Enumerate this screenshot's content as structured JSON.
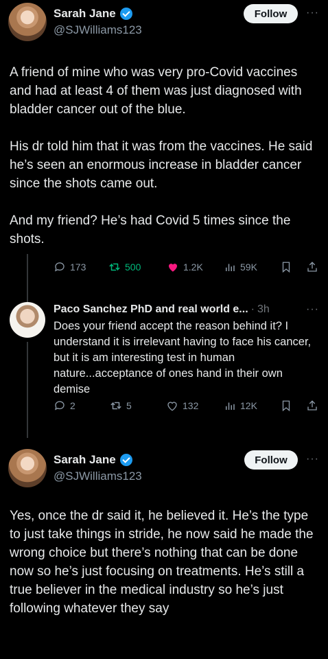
{
  "post1": {
    "author_name": "Sarah Jane",
    "handle": "@SJWilliams123",
    "follow_label": "Follow",
    "more_label": "···",
    "paragraphs": [
      "A friend of mine who was very pro-Covid vaccines and had at least 4 of them was just diagnosed with bladder cancer out of the blue.",
      "His dr told him that it was from the vaccines. He said he’s seen an enormous increase in bladder cancer since the shots came out.",
      "And my friend? He’s had Covid 5 times since the shots."
    ],
    "replies": "173",
    "reposts": "500",
    "likes": "1.2K",
    "views": "59K",
    "like_color": "#f91880",
    "repost_color": "#00ba7c"
  },
  "reply": {
    "author_name": "Paco Sanchez PhD and real world e...",
    "separator": "·",
    "time": "3h",
    "more_label": "···",
    "text": "Does your friend accept the reason behind it? I understand it is irrelevant having to face his cancer,  but it is am interesting test in human nature...acceptance of ones hand in their own demise",
    "replies": "2",
    "reposts": "5",
    "likes": "132",
    "views": "12K"
  },
  "post2": {
    "author_name": "Sarah Jane",
    "handle": "@SJWilliams123",
    "follow_label": "Follow",
    "more_label": "···",
    "text": "Yes, once the dr said it, he believed it. He’s the type to just take things in stride, he now said he made the wrong choice but there’s nothing that can be done now so he’s just focusing on treatments. He’s still a true believer in the medical industry so he’s just following whatever they say"
  },
  "accent_color": "#1d9bf0"
}
